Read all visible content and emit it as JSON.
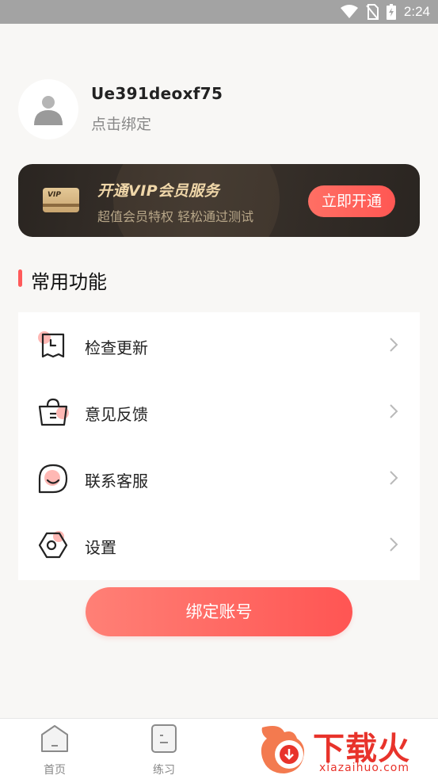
{
  "status_bar": {
    "time": "2:24",
    "icons": [
      "wifi-icon",
      "no-sim-icon",
      "battery-icon"
    ]
  },
  "profile": {
    "username": "Ue391deoxf75",
    "bind_hint": "点击绑定",
    "avatar_icon": "user-icon"
  },
  "vip": {
    "title": "开通VIP会员服务",
    "subtitle": "超值会员特权 轻松通过测试",
    "badge": "VIP",
    "button": "立即开通"
  },
  "section": {
    "title": "常用功能"
  },
  "menu": {
    "items": [
      {
        "label": "检查更新",
        "icon": "clock-doc-icon"
      },
      {
        "label": "意见反馈",
        "icon": "bag-icon"
      },
      {
        "label": "联系客服",
        "icon": "smile-chat-icon"
      },
      {
        "label": "设置",
        "icon": "hex-settings-icon"
      }
    ]
  },
  "bind_button": "绑定账号",
  "tabbar": {
    "tabs": [
      {
        "label": "首页",
        "icon": "home-icon"
      },
      {
        "label": "练习",
        "icon": "practice-icon"
      }
    ]
  },
  "watermark": {
    "text": "下载火",
    "sub": "xiazaihuo.com"
  },
  "colors": {
    "accent": "#ff5a5a",
    "vip_gold": "#f0d7a9",
    "vip_bg": "#2a2521"
  }
}
